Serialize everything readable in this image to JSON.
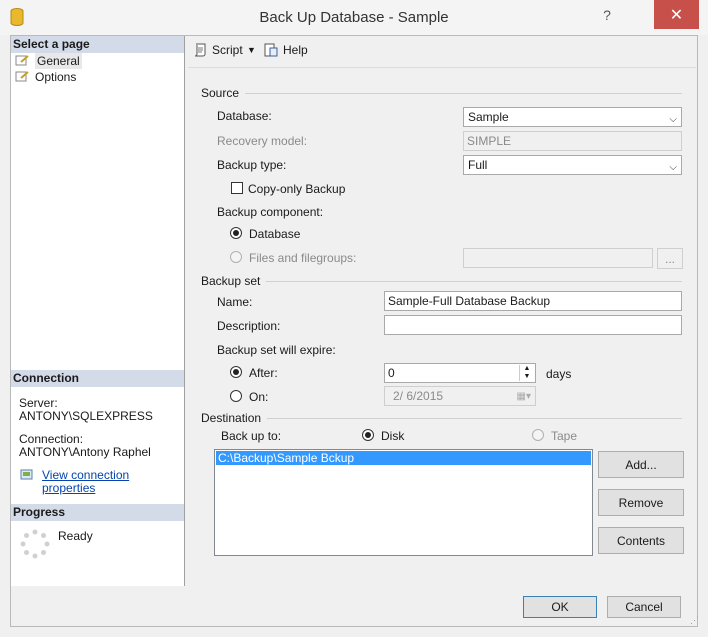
{
  "window": {
    "title": "Back Up Database - Sample",
    "help_glyph": "?",
    "close_glyph": "✕"
  },
  "left": {
    "select_page_header": "Select a page",
    "pages": [
      {
        "label": "General"
      },
      {
        "label": "Options"
      }
    ],
    "connection_header": "Connection",
    "server_label": "Server:",
    "server_value": "ANTONY\\SQLEXPRESS",
    "connection_label": "Connection:",
    "connection_value": "ANTONY\\Antony Raphel",
    "view_props_link": "View connection properties",
    "progress_header": "Progress",
    "progress_status": "Ready"
  },
  "toolbar": {
    "script_label": "Script",
    "help_label": "Help"
  },
  "source": {
    "header": "Source",
    "database_label": "Database:",
    "database_value": "Sample",
    "recovery_label": "Recovery model:",
    "recovery_value": "SIMPLE",
    "backup_type_label": "Backup type:",
    "backup_type_value": "Full",
    "copy_only_label": "Copy-only Backup",
    "component_label": "Backup component:",
    "component_database": "Database",
    "component_files": "Files and filegroups:",
    "browse_label": "..."
  },
  "backup_set": {
    "header": "Backup set",
    "name_label": "Name:",
    "name_value": "Sample-Full Database Backup",
    "description_label": "Description:",
    "description_value": "",
    "expire_label": "Backup set will expire:",
    "after_label": "After:",
    "after_value": "0",
    "days_label": "days",
    "on_label": "On:",
    "on_value": "2/  6/2015"
  },
  "destination": {
    "header": "Destination",
    "backup_to_label": "Back up to:",
    "disk_label": "Disk",
    "tape_label": "Tape",
    "paths": [
      "C:\\Backup\\Sample Bckup"
    ],
    "add_label": "Add...",
    "remove_label": "Remove",
    "contents_label": "Contents"
  },
  "footer": {
    "ok_label": "OK",
    "cancel_label": "Cancel"
  }
}
